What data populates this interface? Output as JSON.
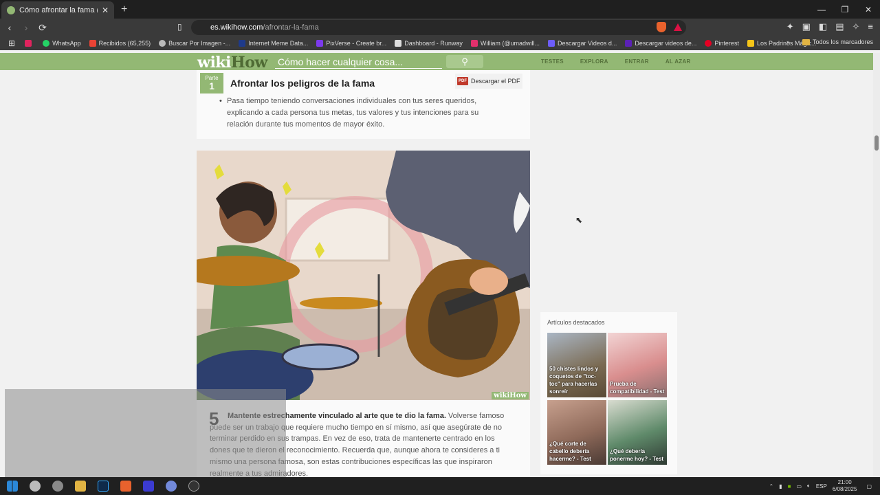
{
  "browser": {
    "tab_title": "Cómo afrontar la fama (con imá",
    "tab_close": "✕",
    "new_tab": "+",
    "url_host": "es.wikihow.com",
    "url_path": "/afrontar-la-fama",
    "bookmarks": [
      {
        "label": "",
        "color": "#e0245e"
      },
      {
        "label": "WhatsApp",
        "color": "#25d366"
      },
      {
        "label": "Recibidos (65,255)",
        "color": "#ea4335"
      },
      {
        "label": "Buscar Por Imagen -...",
        "color": "#bbbbbb"
      },
      {
        "label": "Internet Meme Data...",
        "color": "#1e3a8a"
      },
      {
        "label": "PixVerse - Create br...",
        "color": "#7c3aed"
      },
      {
        "label": "Dashboard - Runway",
        "color": "#dddddd"
      },
      {
        "label": "William (@umadwill...",
        "color": "#e1306c"
      },
      {
        "label": "Descargar Videos d...",
        "color": "#6d5dfc"
      },
      {
        "label": "Descargar videos de...",
        "color": "#5b21b6"
      },
      {
        "label": "Pinterest",
        "color": "#e60023"
      },
      {
        "label": "Los Padrinos Mágic...",
        "color": "#f5c518"
      }
    ],
    "bookmarks_all": "Todos los marcadores"
  },
  "wikihow": {
    "logo_wiki": "wiki",
    "logo_how": "How",
    "search_placeholder": "Cómo hacer cualquier cosa...",
    "nav": [
      "TESTES",
      "EXPLORA",
      "ENTRAR",
      "AL AZAR"
    ]
  },
  "part": {
    "label": "Parte",
    "number": "1",
    "title": "Afrontar los peligros de la fama",
    "pdf_button": "Descargar el PDF",
    "pdf_icon": "PDF",
    "bullet": "Pasa tiempo teniendo conversaciones individuales con tus seres queridos, explicando a cada persona tus metas, tus valores y tus intenciones para su relación durante tus momentos de mayor éxito."
  },
  "illustration": {
    "watermark": "wikiHow"
  },
  "step": {
    "number": "5",
    "bold": "Mantente estrechamente vinculado al arte que te dio la fama.",
    "text": " Volverse famoso puede ser un trabajo que requiere mucho tiempo en sí mismo, así que asegúrate de no terminar perdido en sus trampas. En vez de eso, trata de mantenerte centrado en los dones que te dieron el reconocimiento. Recuerda que, aunque ahora te consideres a ti mismo una persona famosa, son estas contribuciones específicas las que inspiraron realmente a tus admiradores."
  },
  "featured": {
    "title": "Artículos destacados",
    "items": [
      {
        "label": "50 chistes lindos y coquetos de \"toc-toc\" para hacerlas sonreír",
        "color": "#7a6a52"
      },
      {
        "label": "Prueba de compatibilidad - Test",
        "color": "#d98e8e"
      },
      {
        "label": "¿Qué corte de cabello debería hacerme? - Test",
        "color": "#8f6a5a"
      },
      {
        "label": "¿Qué debería ponerme hoy? - Test",
        "color": "#5f8a6a"
      }
    ]
  },
  "taskbar": {
    "lang": "ESP",
    "time": "21:00",
    "date": "6/08/2025"
  }
}
